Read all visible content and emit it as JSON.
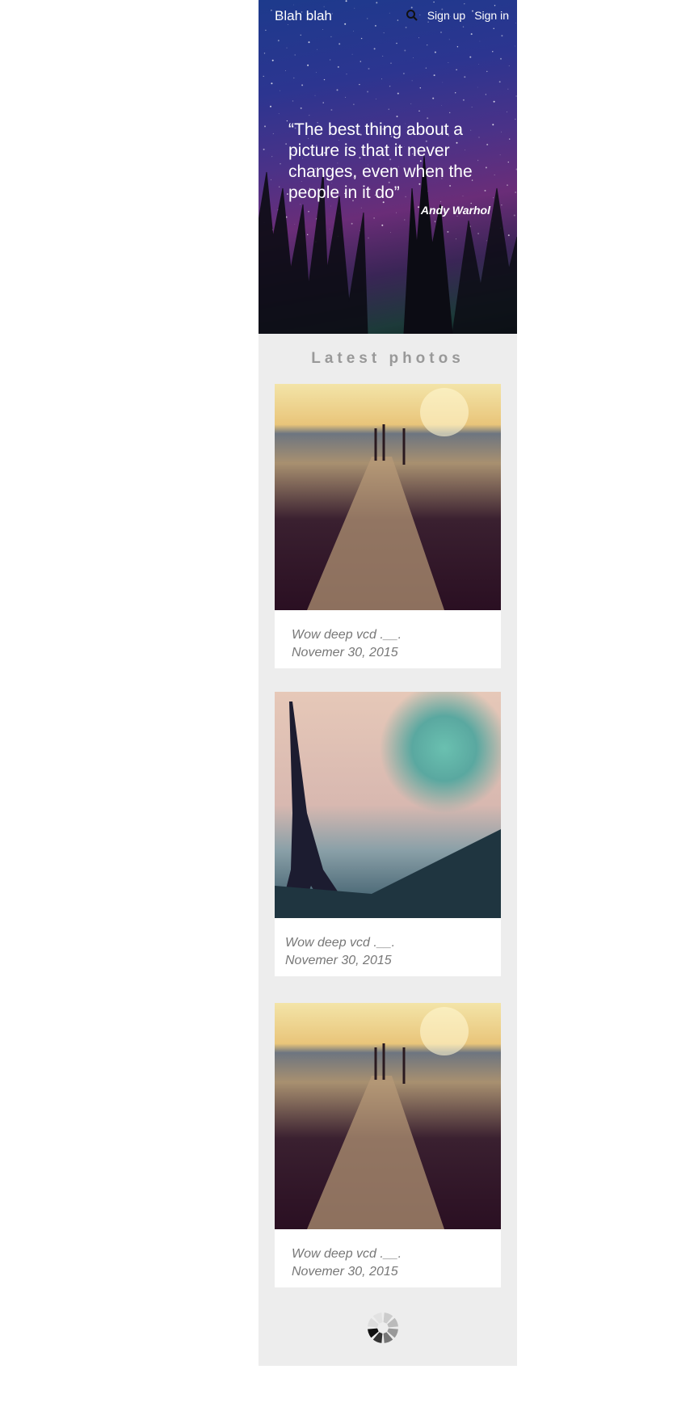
{
  "header": {
    "brand": "Blah blah",
    "search_icon": "search-icon",
    "sign_up": "Sign up",
    "sign_in": "Sign in"
  },
  "hero": {
    "quote": "“The best thing about a picture is that it never changes, even when the people in it do”",
    "author": "Andy Warhol"
  },
  "section_title": "Latest photos",
  "photos": [
    {
      "caption": "Wow  deep vcd .__.",
      "date": "Novemer 30, 2015"
    },
    {
      "caption": "Wow  deep vcd .__.",
      "date": "Novemer 30, 2015"
    },
    {
      "caption": "Wow  deep vcd .__.",
      "date": "Novemer 30, 2015"
    }
  ],
  "loading_icon": "spinner-icon"
}
